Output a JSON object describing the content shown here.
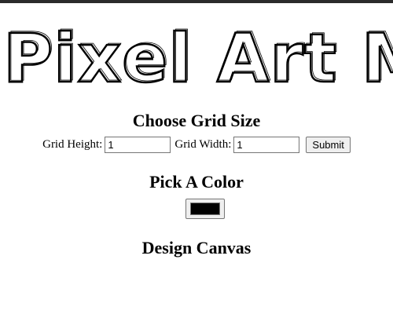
{
  "page": {
    "banner_title": "Pixel Art Maker"
  },
  "grid_size": {
    "title": "Choose Grid Size",
    "height_label": "Grid Height:",
    "height_value": "1",
    "width_label": "Grid Width:",
    "width_value": "1",
    "submit_label": "Submit"
  },
  "color": {
    "title": "Pick A Color",
    "value": "#000000"
  },
  "canvas": {
    "title": "Design Canvas"
  },
  "colors": {
    "text": "#000000",
    "background": "#ffffff"
  }
}
